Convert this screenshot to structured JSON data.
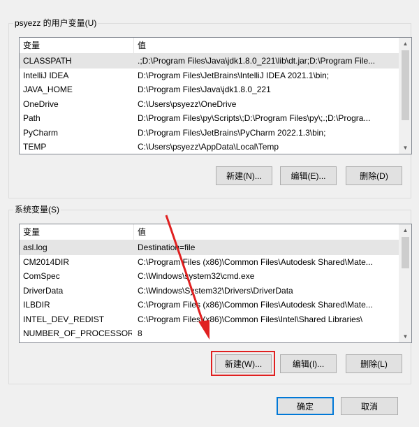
{
  "user_vars": {
    "title": "psyezz 的用户变量(U)",
    "columns": [
      "变量",
      "值"
    ],
    "rows": [
      {
        "name": "CLASSPATH",
        "value": ".;D:\\Program Files\\Java\\jdk1.8.0_221\\lib\\dt.jar;D:\\Program File..."
      },
      {
        "name": "IntelliJ IDEA",
        "value": "D:\\Program Files\\JetBrains\\IntelliJ IDEA 2021.1\\bin;"
      },
      {
        "name": "JAVA_HOME",
        "value": "D:\\Program Files\\Java\\jdk1.8.0_221"
      },
      {
        "name": "OneDrive",
        "value": "C:\\Users\\psyezz\\OneDrive"
      },
      {
        "name": "Path",
        "value": "D:\\Program Files\\py\\Scripts\\;D:\\Program Files\\py\\;.;D:\\Progra..."
      },
      {
        "name": "PyCharm",
        "value": "D:\\Program Files\\JetBrains\\PyCharm 2022.1.3\\bin;"
      },
      {
        "name": "TEMP",
        "value": "C:\\Users\\psyezz\\AppData\\Local\\Temp"
      }
    ],
    "buttons": {
      "new": "新建(N)...",
      "edit": "编辑(E)...",
      "delete": "删除(D)"
    }
  },
  "sys_vars": {
    "title": "系统变量(S)",
    "columns": [
      "变量",
      "值"
    ],
    "rows": [
      {
        "name": "asl.log",
        "value": "Destination=file"
      },
      {
        "name": "CM2014DIR",
        "value": "C:\\Program Files (x86)\\Common Files\\Autodesk Shared\\Mate..."
      },
      {
        "name": "ComSpec",
        "value": "C:\\Windows\\system32\\cmd.exe"
      },
      {
        "name": "DriverData",
        "value": "C:\\Windows\\System32\\Drivers\\DriverData"
      },
      {
        "name": "ILBDIR",
        "value": "C:\\Program Files (x86)\\Common Files\\Autodesk Shared\\Mate..."
      },
      {
        "name": "INTEL_DEV_REDIST",
        "value": "C:\\Program Files (x86)\\Common Files\\Intel\\Shared Libraries\\"
      },
      {
        "name": "NUMBER_OF_PROCESSORS",
        "value": "8"
      }
    ],
    "buttons": {
      "new": "新建(W)...",
      "edit": "编辑(I)...",
      "delete": "删除(L)"
    }
  },
  "dialog_buttons": {
    "ok": "确定",
    "cancel": "取消"
  },
  "annotation_color": "#e02020"
}
